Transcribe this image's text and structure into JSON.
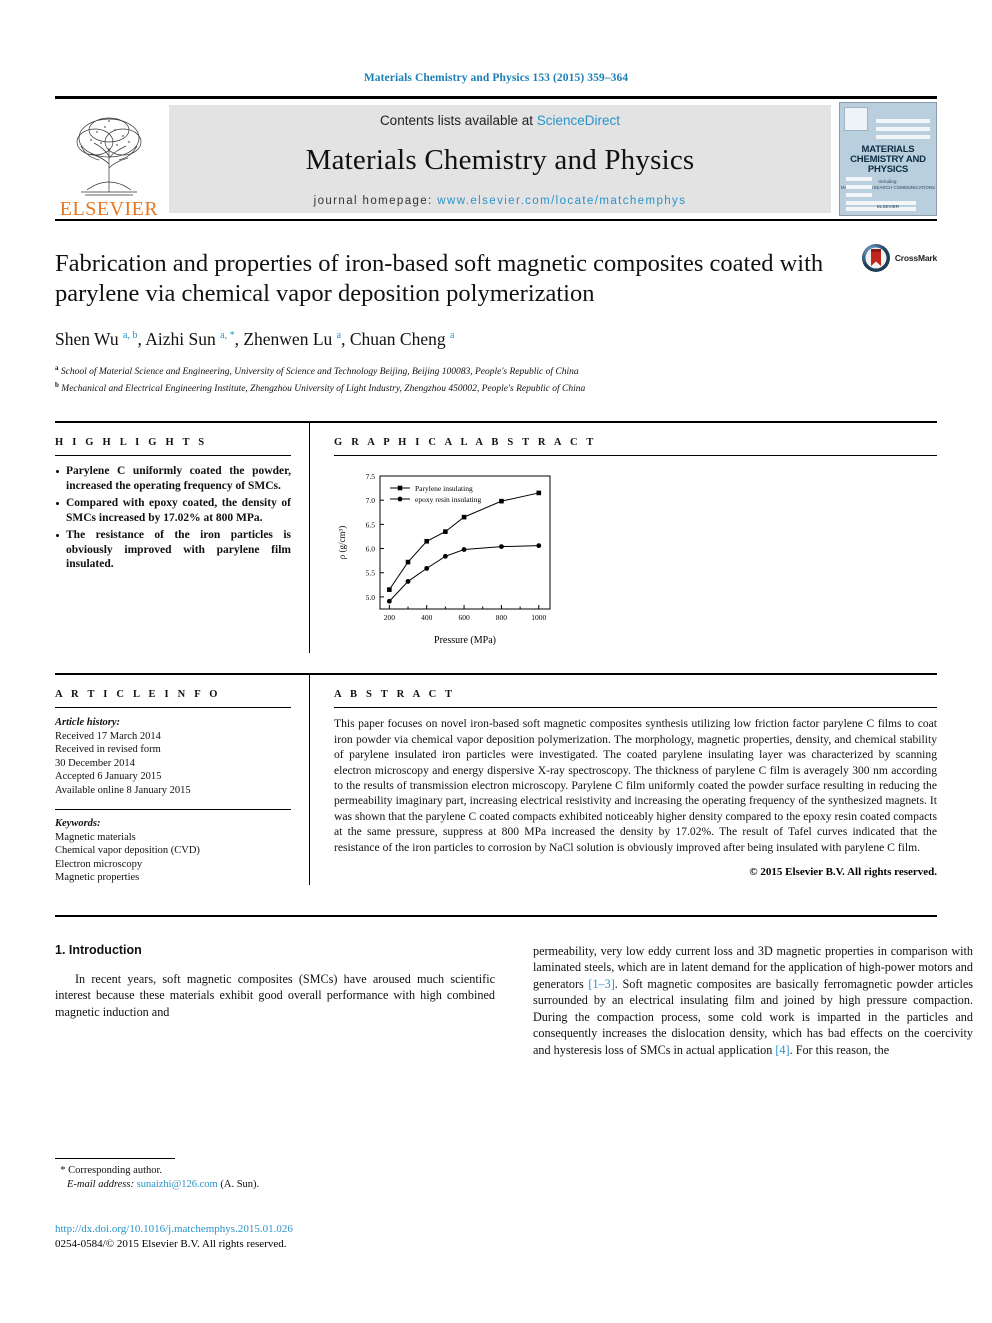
{
  "running_head": "Materials Chemistry and Physics 153 (2015) 359–364",
  "masthead": {
    "publisher": "ELSEVIER",
    "contents_prefix": "Contents lists available at ",
    "contents_link": "ScienceDirect",
    "journal_title": "Materials Chemistry and Physics",
    "homepage_prefix": "journal homepage: ",
    "homepage_url": "www.elsevier.com/locate/matchemphys",
    "cover": {
      "title_line1": "MATERIALS",
      "title_line2": "CHEMISTRY AND",
      "title_line3": "PHYSICS",
      "sub_line1": "Including:",
      "sub_line2": "MATERIALS RESEARCH COMMUNICATIONS",
      "foot": "ELSEVIER"
    }
  },
  "article": {
    "title": "Fabrication and properties of iron-based soft magnetic composites coated with parylene via chemical vapor deposition polymerization",
    "crossmark_label": "CrossMark",
    "authors_html": "Shen Wu <sup>a, b</sup>, Aizhi Sun <sup>a, *</sup>, Zhenwen Lu <sup>a</sup>, Chuan Cheng <sup>a</sup>",
    "affiliations": [
      {
        "marker": "a",
        "text": "School of Material Science and Engineering, University of Science and Technology Beijing, Beijing 100083, People's Republic of China"
      },
      {
        "marker": "b",
        "text": "Mechanical and Electrical Engineering Institute, Zhengzhou University of Light Industry, Zhengzhou 450002, People's Republic of China"
      }
    ]
  },
  "highlights": {
    "heading": "H I G H L I G H T S",
    "items": [
      "Parylene C uniformly coated the powder, increased the operating frequency of SMCs.",
      "Compared with epoxy coated, the density of SMCs increased by 17.02% at 800 MPa.",
      "The resistance of the iron particles is obviously improved with parylene film insulated."
    ]
  },
  "graphical_abstract": {
    "heading": "G R A P H I C A L  A B S T R A C T"
  },
  "chart_data": {
    "type": "line",
    "title": "",
    "xlabel": "Pressure (MPa)",
    "ylabel": "ρ (g/cm³)",
    "xlim": [
      150,
      1060
    ],
    "ylim": [
      4.75,
      7.5
    ],
    "xticks": [
      200,
      400,
      600,
      800,
      1000
    ],
    "yticks": [
      5.0,
      5.5,
      6.0,
      6.5,
      7.0,
      7.5
    ],
    "grid": false,
    "legend_position": "top-left",
    "series": [
      {
        "name": "Parylene insulating",
        "marker": "square",
        "x": [
          200,
          300,
          400,
          500,
          600,
          800,
          1000
        ],
        "y": [
          5.15,
          5.72,
          6.15,
          6.35,
          6.65,
          6.98,
          7.15
        ]
      },
      {
        "name": "epoxy resin insulating",
        "marker": "circle",
        "x": [
          200,
          300,
          400,
          500,
          600,
          800,
          1000
        ],
        "y": [
          4.91,
          5.32,
          5.59,
          5.84,
          5.98,
          6.04,
          6.06
        ]
      }
    ]
  },
  "article_info": {
    "heading": "A R T I C L E  I N F O",
    "history_label": "Article history:",
    "history_lines": [
      "Received 17 March 2014",
      "Received in revised form",
      "30 December 2014",
      "Accepted 6 January 2015",
      "Available online 8 January 2015"
    ],
    "keywords_label": "Keywords:",
    "keywords": [
      "Magnetic materials",
      "Chemical vapor deposition (CVD)",
      "Electron microscopy",
      "Magnetic properties"
    ]
  },
  "abstract": {
    "heading": "A B S T R A C T",
    "text": "This paper focuses on novel iron-based soft magnetic composites synthesis utilizing low friction factor parylene C films to coat iron powder via chemical vapor deposition polymerization. The morphology, magnetic properties, density, and chemical stability of parylene insulated iron particles were investigated. The coated parylene insulating layer was characterized by scanning electron microscopy and energy dispersive X-ray spectroscopy. The thickness of parylene C film is averagely 300 nm according to the results of transmission electron microscopy. Parylene C film uniformly coated the powder surface resulting in reducing the permeability imaginary part, increasing electrical resistivity and increasing the operating frequency of the synthesized magnets. It was shown that the parylene C coated compacts exhibited noticeably higher density compared to the epoxy resin coated compacts at the same pressure, suppress at 800 MPa increased the density by 17.02%. The result of Tafel curves indicated that the resistance of the iron particles to corrosion by NaCl solution is obviously improved after being insulated with parylene C film.",
    "copyright": "© 2015 Elsevier B.V. All rights reserved."
  },
  "introduction": {
    "section_number_title": "1.  Introduction",
    "left_paragraph": "In recent years, soft magnetic composites (SMCs) have aroused much scientific interest because these materials exhibit good overall performance with high combined magnetic induction and",
    "right_part1": "permeability, very low eddy current loss and 3D magnetic properties in comparison with laminated steels, which are in latent demand for the application of high-power motors and generators ",
    "right_ref1": "[1–3]",
    "right_part2": ". Soft magnetic composites are basically ferromagnetic powder articles surrounded by an electrical insulating film and joined by high pressure compaction. During the compaction process, some cold work is imparted in the particles and consequently increases the dislocation density, which has bad effects on the coercivity and hysteresis loss of SMCs in actual application ",
    "right_ref2": "[4]",
    "right_part3": ". For this reason, the"
  },
  "footer": {
    "corresponding_marker": "*",
    "corresponding_label": "Corresponding author.",
    "email_label": "E-mail address:",
    "email": "sunaizhi@126.com",
    "email_suffix": "(A. Sun).",
    "doi": "http://dx.doi.org/10.1016/j.matchemphys.2015.01.026",
    "issn_line": "0254-0584/© 2015 Elsevier B.V. All rights reserved."
  },
  "colors": {
    "link": "#2a93c9",
    "elsevier_orange": "#e87722",
    "header_blue": "#1b7fb5"
  }
}
